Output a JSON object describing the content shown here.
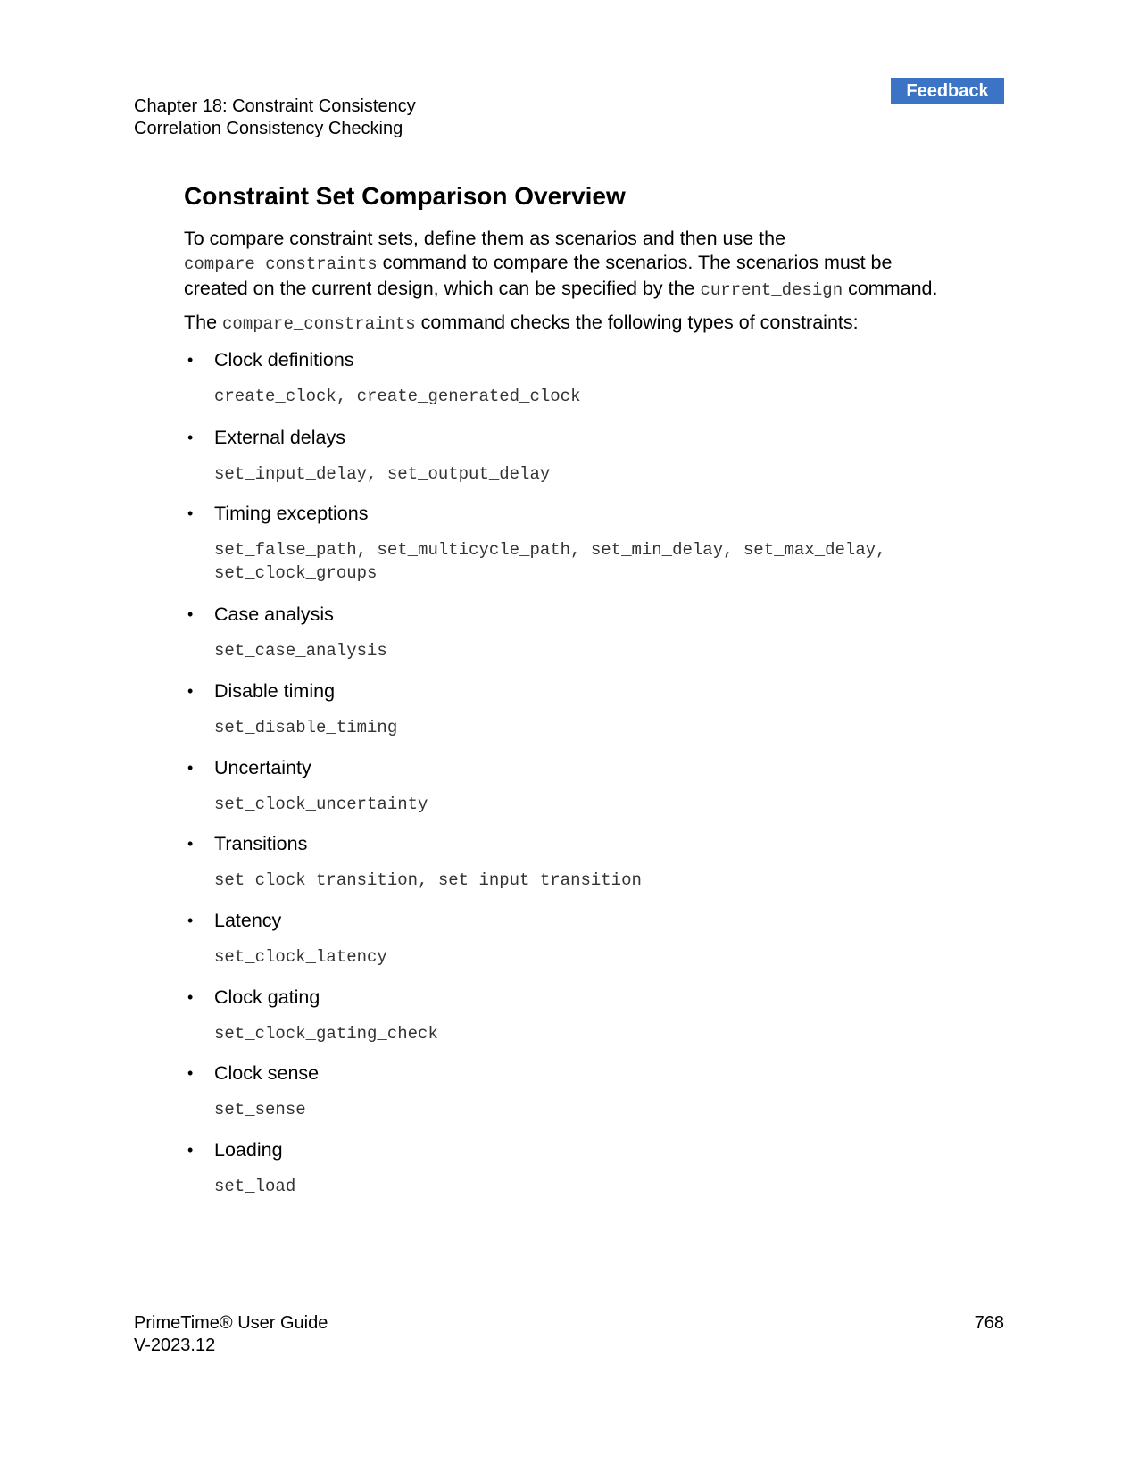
{
  "header": {
    "chapter": "Chapter 18: Constraint Consistency",
    "section": "Correlation Consistency Checking",
    "feedback_label": "Feedback"
  },
  "title": "Constraint Set Comparison Overview",
  "intro": {
    "p1_a": "To compare constraint sets, define them as scenarios and then use the",
    "p1_code1": "compare_constraints",
    "p1_b": " command to compare the scenarios. The scenarios must be",
    "p1_c": "created on the current design, which can be specified by the ",
    "p1_code2": "current_design",
    "p1_d": " command.",
    "p2_a": "The ",
    "p2_code": "compare_constraints",
    "p2_b": " command checks the following types of constraints:"
  },
  "items": [
    {
      "label": "Clock definitions",
      "lines": [
        "create_clock, create_generated_clock"
      ]
    },
    {
      "label": "External delays",
      "lines": [
        "set_input_delay, set_output_delay"
      ]
    },
    {
      "label": "Timing exceptions",
      "lines": [
        "set_false_path, set_multicycle_path, set_min_delay, set_max_delay,",
        "set_clock_groups"
      ]
    },
    {
      "label": "Case analysis",
      "lines": [
        "set_case_analysis"
      ]
    },
    {
      "label": "Disable timing",
      "lines": [
        "set_disable_timing"
      ]
    },
    {
      "label": "Uncertainty",
      "lines": [
        "set_clock_uncertainty"
      ]
    },
    {
      "label": "Transitions",
      "lines": [
        "set_clock_transition, set_input_transition"
      ]
    },
    {
      "label": "Latency",
      "lines": [
        "set_clock_latency"
      ]
    },
    {
      "label": "Clock gating",
      "lines": [
        "set_clock_gating_check"
      ]
    },
    {
      "label": "Clock sense",
      "lines": [
        "set_sense"
      ]
    },
    {
      "label": "Loading",
      "lines": [
        "set_load"
      ]
    }
  ],
  "footer": {
    "product": "PrimeTime® User Guide",
    "version": "V-2023.12",
    "page": "768"
  },
  "colors": {
    "feedback_bg": "#3b74c4"
  }
}
